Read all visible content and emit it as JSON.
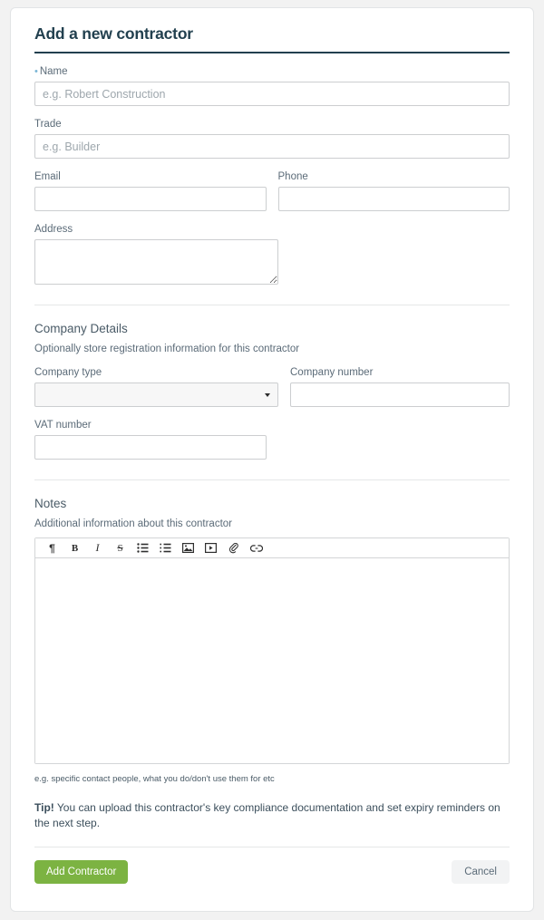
{
  "form": {
    "title": "Add a new contractor",
    "fields": {
      "name": {
        "label": "Name",
        "required_marker": "•",
        "placeholder": "e.g. Robert Construction",
        "value": ""
      },
      "trade": {
        "label": "Trade",
        "placeholder": "e.g. Builder",
        "value": ""
      },
      "email": {
        "label": "Email",
        "placeholder": "",
        "value": ""
      },
      "phone": {
        "label": "Phone",
        "placeholder": "",
        "value": ""
      },
      "address": {
        "label": "Address",
        "placeholder": "",
        "value": ""
      }
    }
  },
  "company_details": {
    "title": "Company Details",
    "subtitle": "Optionally store registration information for this contractor",
    "company_type": {
      "label": "Company type",
      "selected": "",
      "options": [
        ""
      ]
    },
    "company_number": {
      "label": "Company number",
      "placeholder": "",
      "value": ""
    },
    "vat_number": {
      "label": "VAT number",
      "placeholder": "",
      "value": ""
    }
  },
  "notes": {
    "title": "Notes",
    "subtitle": "Additional information about this contractor",
    "toolbar": [
      {
        "name": "paragraph-icon",
        "glyph": "¶"
      },
      {
        "name": "bold-icon",
        "glyph": "B"
      },
      {
        "name": "italic-icon",
        "glyph": "I"
      },
      {
        "name": "strikethrough-icon",
        "glyph": "S"
      },
      {
        "name": "bullet-list-icon",
        "glyph": ""
      },
      {
        "name": "numbered-list-icon",
        "glyph": ""
      },
      {
        "name": "image-icon",
        "glyph": ""
      },
      {
        "name": "video-icon",
        "glyph": ""
      },
      {
        "name": "attachment-icon",
        "glyph": ""
      },
      {
        "name": "link-icon",
        "glyph": ""
      }
    ],
    "content": "",
    "hint": "e.g. specific contact people, what you do/don't use them for etc"
  },
  "tip": {
    "bold_prefix": "Tip!",
    "text": " You can upload this contractor's key compliance documentation and set expiry reminders on the next step."
  },
  "actions": {
    "submit_label": "Add Contractor",
    "cancel_label": "Cancel"
  },
  "colors": {
    "accent_green": "#7cb342",
    "title_navy": "#22404f",
    "required_blue": "#7bb6d6",
    "page_background": "#f2f2f2"
  }
}
